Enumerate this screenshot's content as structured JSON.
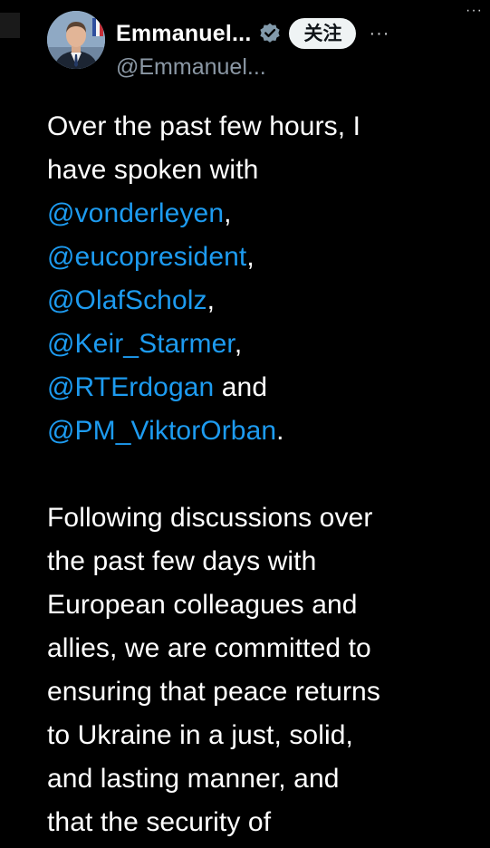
{
  "window": {
    "corner_menu_glyph": "···"
  },
  "author": {
    "display_name": "Emmanuel...",
    "handle": "@Emmanuel...",
    "avatar_icon": "portrait-avatar",
    "verified_icon": "verified-badge-icon",
    "verified_color": "#829aab",
    "follow_label": "关注",
    "more_glyph": "···"
  },
  "tweet": {
    "p1": {
      "line1": "Over the past few hours, I",
      "line2": "have spoken with",
      "m1": "@vonderleyen",
      "s1": ",",
      "m2": "@eucopresident",
      "s2": ",",
      "m3": "@OlafScholz",
      "s3": ",",
      "m4": "@Keir_Starmer",
      "s4": ",",
      "m5": "@RTErdogan",
      "s5": " and",
      "m6": "@PM_ViktorOrban",
      "s6": "."
    },
    "p2": {
      "l1": "Following discussions over",
      "l2": "the past few days with",
      "l3": "European colleagues and",
      "l4": "allies, we are committed to",
      "l5": "ensuring that peace returns",
      "l6": "to Ukraine in a just, solid,",
      "l7": "and lasting manner, and",
      "l8": "that the security of"
    }
  },
  "colors": {
    "background": "#000000",
    "text": "#ffffff",
    "mention": "#1d9bf0",
    "secondary": "#8b98a5",
    "follow_bg": "#eff3f4"
  }
}
